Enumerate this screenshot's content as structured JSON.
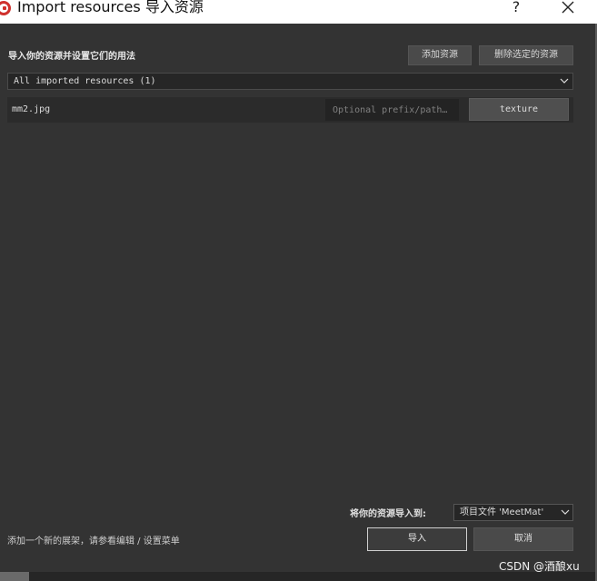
{
  "window": {
    "title": "Import resources 导入资源",
    "help_label": "?",
    "app_icon": "app-logo-icon",
    "close_icon": "close-icon"
  },
  "header": {
    "heading": "导入你的资源并设置它们的用法",
    "add_button": "添加资源",
    "delete_button": "删除选定的资源"
  },
  "filter": {
    "selected": "All imported resources (1)",
    "icon": "chevron-down-icon"
  },
  "resources": [
    {
      "name": "mm2.jpg",
      "prefix_placeholder": "Optional prefix/path…",
      "type": "texture"
    }
  ],
  "footer": {
    "target_label": "将你的资源导入到:",
    "target_selected": "项目文件 'MeetMat'",
    "hint": "添加一个新的展架，请参看编辑 / 设置菜单",
    "import_button": "导入",
    "cancel_button": "取消"
  },
  "watermark": "CSDN @酒酿xu",
  "colors": {
    "background": "#333333",
    "title_bar": "#ffffff",
    "accent_icon": "#d0312d"
  }
}
